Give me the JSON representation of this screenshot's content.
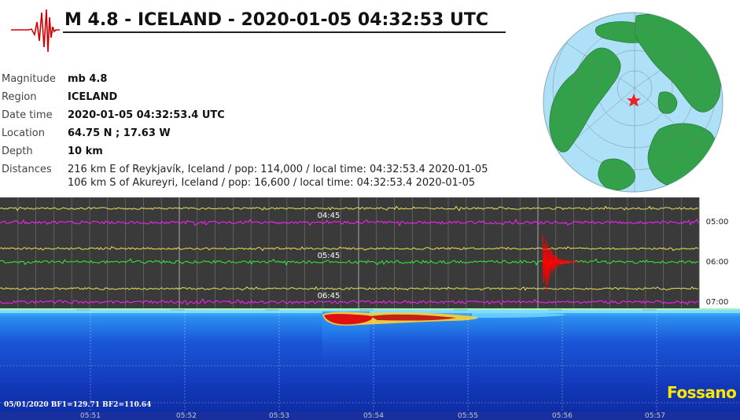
{
  "title": "M 4.8 - ICELAND - 2020-01-05 04:32:53 UTC",
  "details": [
    {
      "label": "Magnitude",
      "value": "mb 4.8"
    },
    {
      "label": "Region",
      "value": "ICELAND"
    },
    {
      "label": "Date time",
      "value": "2020-01-05 04:32:53.4 UTC"
    },
    {
      "label": "Location",
      "value": "64.75 N ; 17.63 W"
    },
    {
      "label": "Depth",
      "value": "10 km"
    }
  ],
  "distances_label": "Distances",
  "distances": [
    "216 km E of Reykjavík, Iceland / pop: 114,000 / local time: 04:32:53.4 2020-01-05",
    "106 km S of Akureyri, Iceland / pop: 16,600 / local time: 04:32:53.4 2020-01-05"
  ],
  "map": {
    "icon": "globe-map-icon",
    "epicenter_marker": "red-star-icon"
  },
  "helicorder": {
    "inner_labels": [
      "04:45",
      "05:45",
      "06:45"
    ],
    "right_labels": [
      "05:00",
      "06:00",
      "07:00"
    ],
    "colors": {
      "background": "#3c3c3c",
      "trace_a": "#e6e65a",
      "trace_b": "#ff20ff",
      "trace_c": "#33ee33",
      "event": "#ff0000"
    }
  },
  "spectrogram": {
    "left_label": "05/01/2020 BF1=129.71 BF2=110.64",
    "station": "Fossano",
    "time_ticks": [
      "05:51",
      "05:52",
      "05:53",
      "05:54",
      "05:55",
      "05:56",
      "05:57"
    ]
  }
}
